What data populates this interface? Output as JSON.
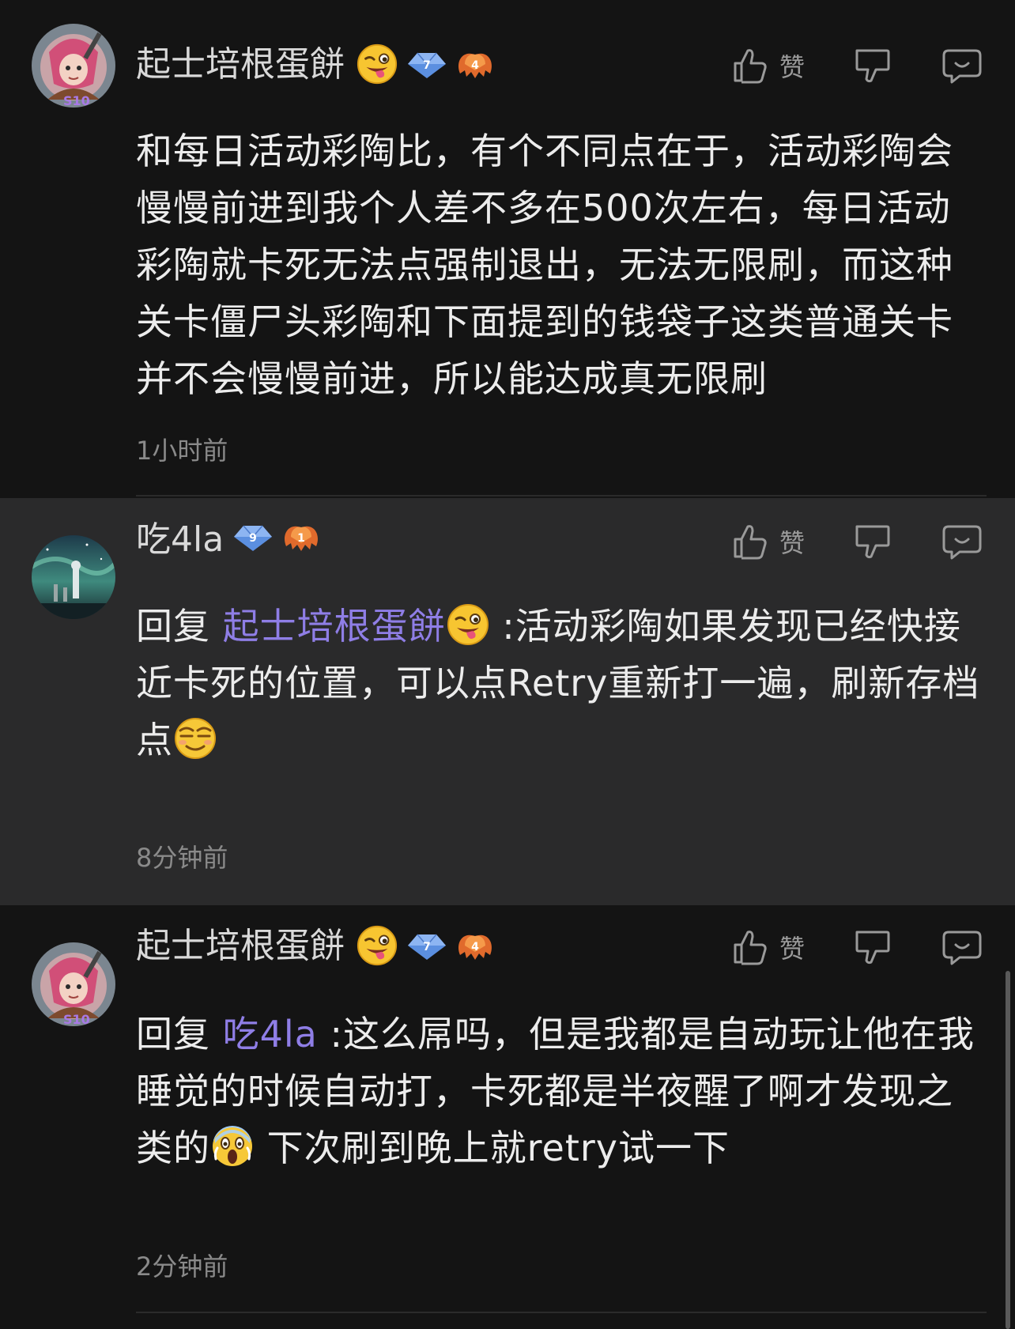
{
  "colors": {
    "background": "#141414",
    "highlighted_background": "#2a2a2b",
    "mention": "#8f7ee6",
    "timestamp": "#8a8a8a",
    "text": "#ececec"
  },
  "comments": [
    {
      "username": "起士培根蛋餅",
      "user_emoji": "winking-tongue-emoji",
      "level": "7",
      "rank_badge": "4",
      "avatar_tag": "S10",
      "like_label": "赞",
      "text": "和每日活动彩陶比，有个不同点在于，活动彩陶会慢慢前进到我个人差不多在500次左右，每日活动彩陶就卡死无法点强制退出，无法无限刷，而这种关卡僵尸头彩陶和下面提到的钱袋子这类普通关卡并不会慢慢前进，所以能达成真无限刷",
      "timestamp": "1小时前"
    },
    {
      "username": "吃4la",
      "level": "9",
      "rank_badge": "1",
      "like_label": "赞",
      "reply_prefix": "回复 ",
      "mention": "起士培根蛋餅",
      "mention_emoji": "winking-tongue-emoji",
      "text": " :活动彩陶如果发现已经快接近卡死的位置，可以点Retry重新打一遍，刷新存档点",
      "trailing_emoji": "smug-face-emoji",
      "timestamp": "8分钟前"
    },
    {
      "username": "起士培根蛋餅",
      "user_emoji": "winking-tongue-emoji",
      "level": "7",
      "rank_badge": "4",
      "avatar_tag": "S10",
      "like_label": "赞",
      "reply_prefix": "回复 ",
      "mention": "吃4la",
      "text_before_emoji": " :这么屌吗，但是我都是自动玩让他在我睡觉的时候自动打，卡死都是半夜醒了啊才发现之类的",
      "inline_emoji": "screaming-face-emoji",
      "text_after_emoji": " 下次刷到晚上就retry试一下",
      "timestamp": "2分钟前"
    }
  ]
}
